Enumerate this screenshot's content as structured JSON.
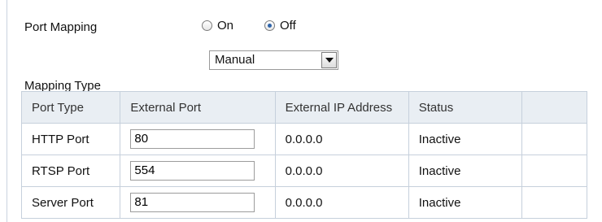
{
  "port_mapping": {
    "label": "Port Mapping",
    "options": [
      "On",
      "Off"
    ],
    "selected": "Off"
  },
  "mapping_type": {
    "label": "Mapping Type",
    "value": "Manual"
  },
  "table": {
    "headers": [
      "Port Type",
      "External Port",
      "External IP Address",
      "Status",
      ""
    ],
    "rows": [
      {
        "port_type": "HTTP Port",
        "external_port": "80",
        "external_ip": "0.0.0.0",
        "status": "Inactive"
      },
      {
        "port_type": "RTSP Port",
        "external_port": "554",
        "external_ip": "0.0.0.0",
        "status": "Inactive"
      },
      {
        "port_type": "Server Port",
        "external_port": "81",
        "external_ip": "0.0.0.0",
        "status": "Inactive"
      }
    ]
  }
}
